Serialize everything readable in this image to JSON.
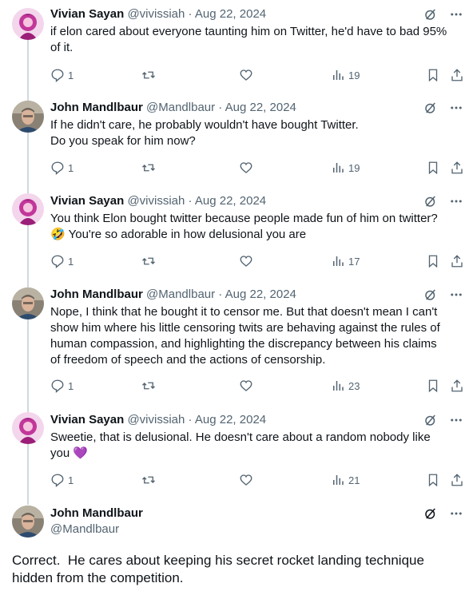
{
  "tweets": [
    {
      "author": "Vivian Sayan",
      "handle": "@vivissiah",
      "separator": "·",
      "date": "Aug 22, 2024",
      "text_lines": [
        "if elon cared about everyone taunting him on Twitter, he'd have to bad 95%",
        "of it."
      ],
      "replies": "1",
      "views": "19",
      "avatar": "pink-anime-avatar"
    },
    {
      "author": "John Mandlbaur",
      "handle": "@Mandlbaur",
      "separator": "·",
      "date": "Aug 22, 2024",
      "text_lines": [
        "If he didn't care, he probably wouldn't have bought Twitter.",
        "Do you speak for him now?"
      ],
      "replies": "1",
      "views": "19",
      "avatar": "man-portrait-avatar"
    },
    {
      "author": "Vivian Sayan",
      "handle": "@vivissiah",
      "separator": "·",
      "date": "Aug 22, 2024",
      "text_lines": [
        "You think Elon bought twitter because people made fun of him on twitter?",
        "You're so adorable in how delusional you are"
      ],
      "emoji": "🤣",
      "replies": "1",
      "views": "17",
      "avatar": "pink-anime-avatar"
    },
    {
      "author": "John Mandlbaur",
      "handle": "@Mandlbaur",
      "separator": "·",
      "date": "Aug 22, 2024",
      "text_lines": [
        "Nope, I think that he bought it to censor me. But that doesn't mean I can't",
        "show him where his little censoring twits are behaving against the rules of",
        "human compassion, and highlighting the discrepancy between his claims",
        "of freedom of speech and the actions of censorship."
      ],
      "replies": "1",
      "views": "23",
      "avatar": "man-portrait-avatar"
    },
    {
      "author": "Vivian Sayan",
      "handle": "@vivissiah",
      "separator": "·",
      "date": "Aug 22, 2024",
      "text_lines": [
        "Sweetie, that is delusional. He doesn't care about a random nobody like",
        "you"
      ],
      "emoji": "💜",
      "replies": "1",
      "views": "21",
      "avatar": "pink-anime-avatar"
    }
  ],
  "main_tweet": {
    "author": "John Mandlbaur",
    "handle": "@Mandlbaur",
    "text_lines": [
      "Correct.  He cares about keeping his secret rocket landing technique",
      "hidden from the competition."
    ],
    "avatar": "man-portrait-avatar"
  },
  "icons": {
    "reply": "reply-icon",
    "retweet": "retweet-icon",
    "like": "heart-icon",
    "views": "views-icon",
    "bookmark": "bookmark-icon",
    "share": "share-icon",
    "grok": "grok-icon",
    "more": "more-icon"
  },
  "colors": {
    "text": "#0f1419",
    "secondary": "#536471",
    "thread_line": "#cfd9de"
  }
}
